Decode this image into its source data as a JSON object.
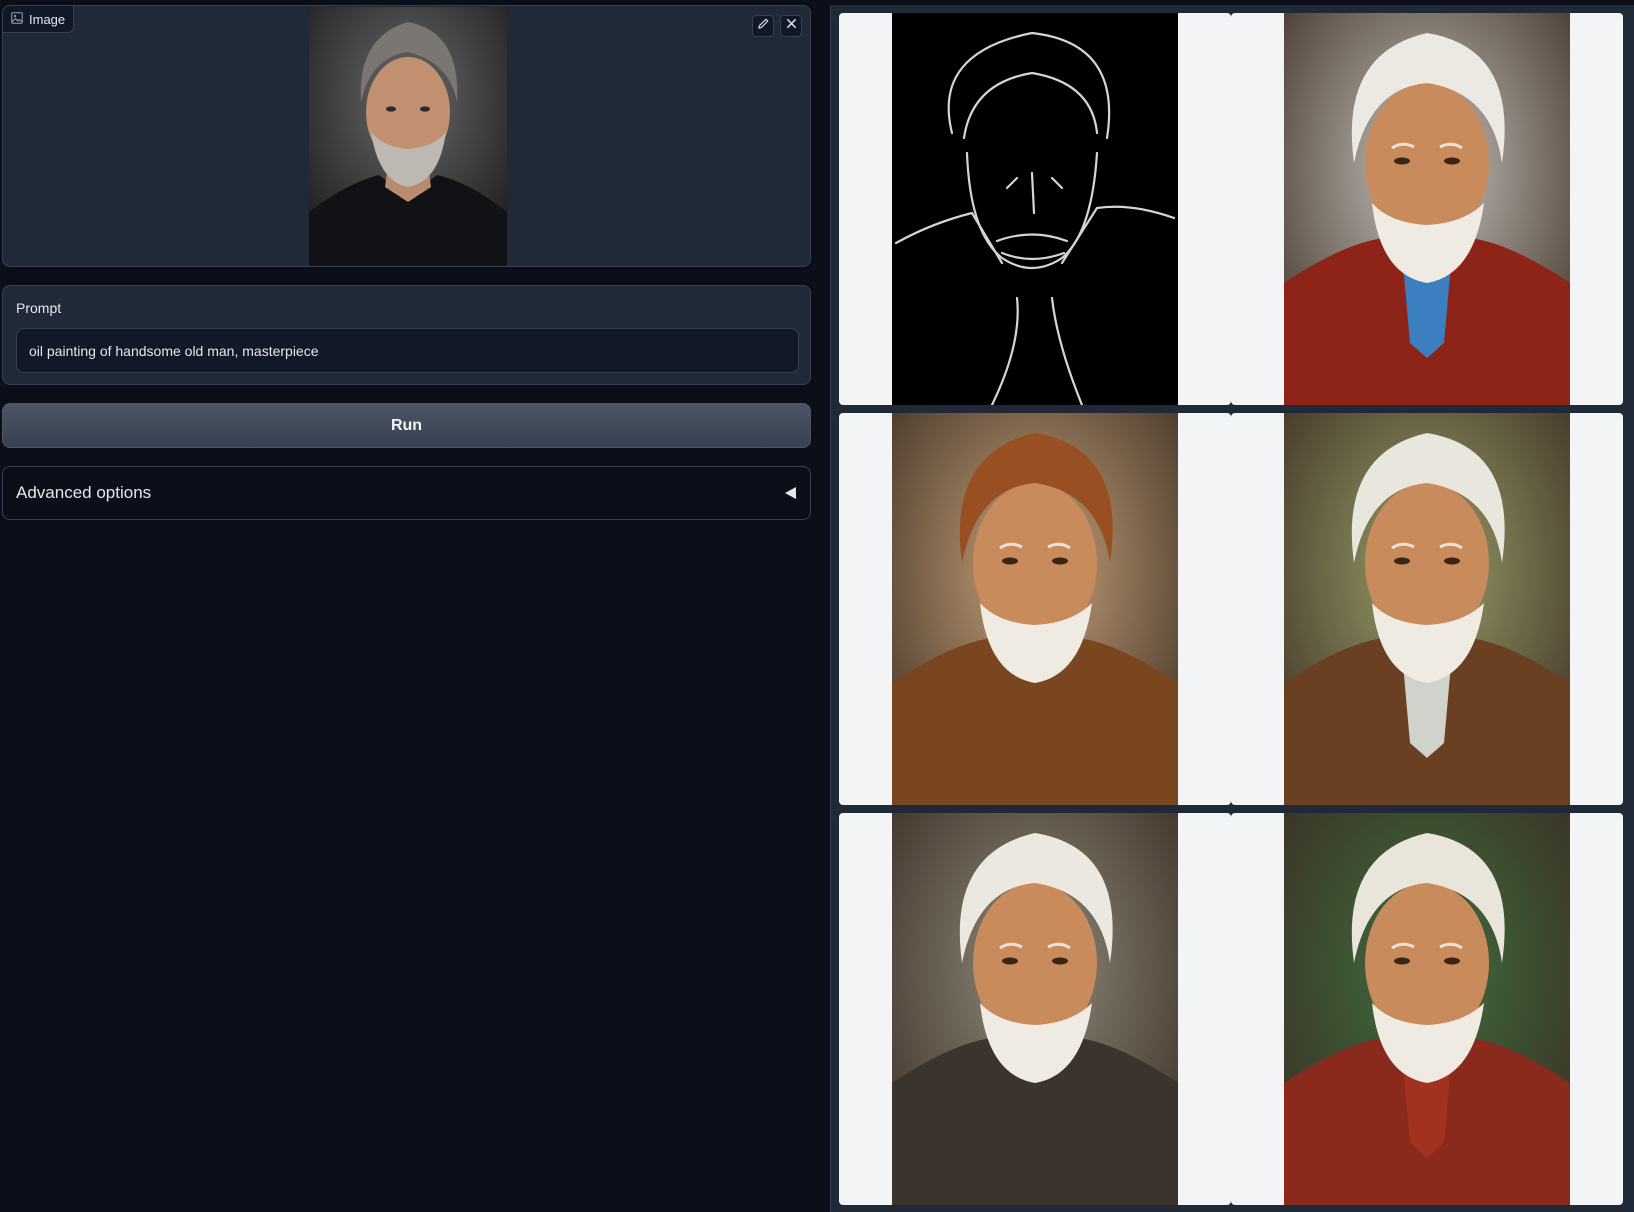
{
  "image_input": {
    "label": "Image",
    "icon": "image-icon",
    "tools": [
      "edit-icon",
      "close-icon"
    ]
  },
  "prompt": {
    "label": "Prompt",
    "value": "oil painting of handsome old man, masterpiece"
  },
  "run_button": {
    "label": "Run"
  },
  "advanced": {
    "label": "Advanced options",
    "icon": "caret-left-icon"
  },
  "gallery": {
    "items": [
      {
        "kind": "edge-map"
      },
      {
        "kind": "portrait",
        "shirt": "#8e2418",
        "scarf": "#3b7fc0",
        "bg": "#c8c4bd",
        "hair": "#ece9e2"
      },
      {
        "kind": "portrait",
        "shirt": "#7a4620",
        "scarf": "#7a4620",
        "bg": "#c8a47a",
        "hair": "#9a4f22"
      },
      {
        "kind": "portrait",
        "shirt": "#6a3f22",
        "scarf": "#cfd3cc",
        "bg": "#9aa06a",
        "hair": "#e9e6de"
      },
      {
        "kind": "portrait",
        "shirt": "#3a342c",
        "scarf": "#3a342c",
        "bg": "#8f8a7c",
        "hair": "#ece8df"
      },
      {
        "kind": "portrait",
        "shirt": "#8a2a1c",
        "scarf": "#a3311f",
        "bg": "#3f6e3f",
        "hair": "#eae5da"
      }
    ]
  }
}
